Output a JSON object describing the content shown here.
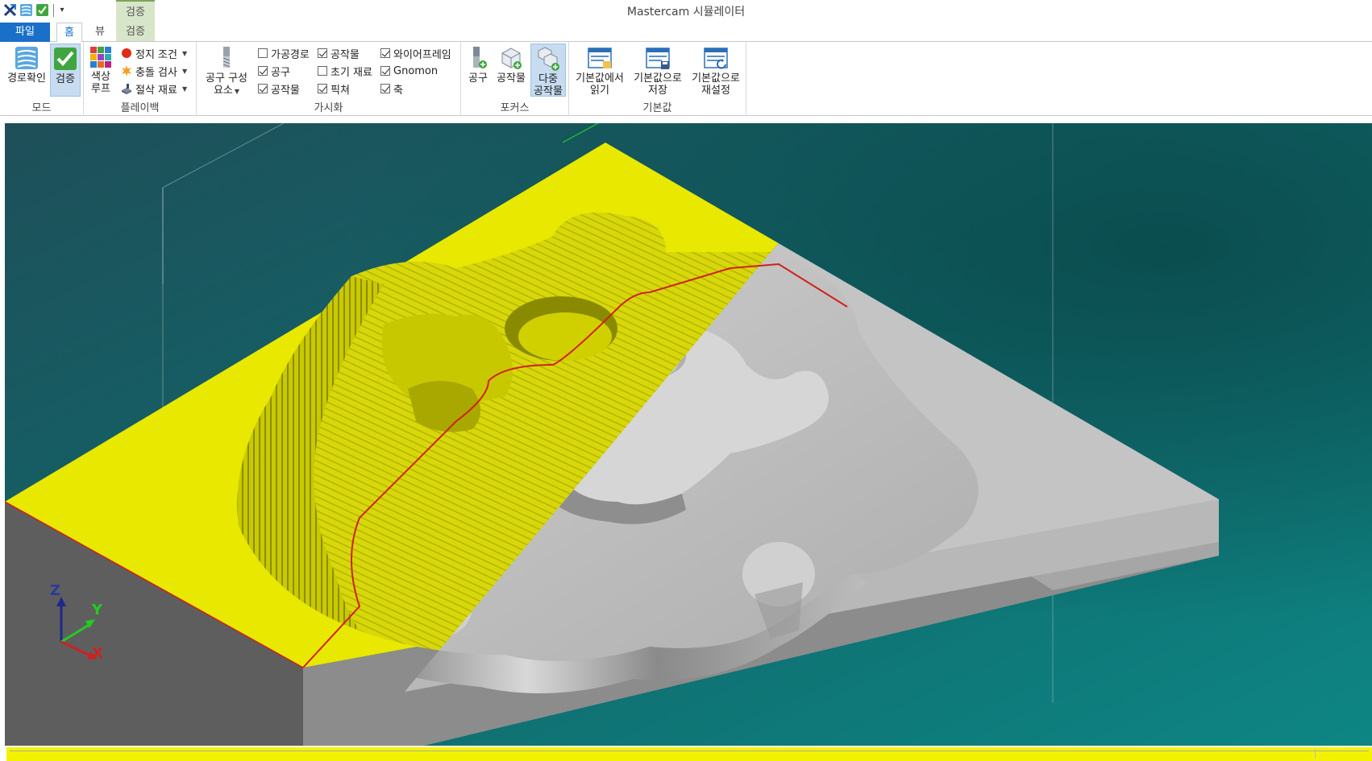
{
  "app": {
    "title": "Mastercam 시뮬레이터"
  },
  "context_group": {
    "label": "검증"
  },
  "tabs": [
    {
      "label": "파일"
    },
    {
      "label": "홈"
    },
    {
      "label": "뷰"
    },
    {
      "label": "검증"
    }
  ],
  "ribbon": {
    "mode": {
      "label": "모드",
      "backplot": "경로확인",
      "verify": "검증"
    },
    "playback": {
      "label": "플레이백",
      "color_loop_line1": "색상",
      "color_loop_line2": "루프",
      "stop_conditions": "정지 조건",
      "collision_check": "충돌 검사",
      "cut_stock": "절삭 재료"
    },
    "visibility": {
      "label": "가시화",
      "tool_components_line1": "공구 구성",
      "tool_components_line2": "요소",
      "toolpaths": {
        "label": "가공경로",
        "checked": false
      },
      "tool": {
        "label": "공구",
        "checked": true
      },
      "workpiece_a": {
        "label": "공작물",
        "checked": true
      },
      "workpiece_b": {
        "label": "공작물",
        "checked": true
      },
      "initial_stock": {
        "label": "초기 재료",
        "checked": false
      },
      "fixture": {
        "label": "픽쳐",
        "checked": true
      },
      "wireframe": {
        "label": "와이어프레임",
        "checked": true
      },
      "gnomon": {
        "label": "Gnomon",
        "checked": true
      },
      "axes": {
        "label": "축",
        "checked": true
      }
    },
    "focus": {
      "label": "포커스",
      "tool": "공구",
      "workpiece": "공작물",
      "multi_line1": "다중",
      "multi_line2": "공작물"
    },
    "defaults": {
      "label": "기본값",
      "load_line1": "기본값에서",
      "load_line2": "읽기",
      "save_line1": "기본값으로",
      "save_line2": "저장",
      "reset_line1": "기본값으로",
      "reset_line2": "재설정"
    }
  },
  "gnomon": {
    "z": "Z",
    "y": "Y",
    "x": "X"
  },
  "colors": {
    "accent": "#1a6fc9",
    "stock_yellow": "#e6e600",
    "part_gray": "#b9b9b9",
    "background_teal": "#0e6e70",
    "boundary_red": "#d0201a"
  }
}
